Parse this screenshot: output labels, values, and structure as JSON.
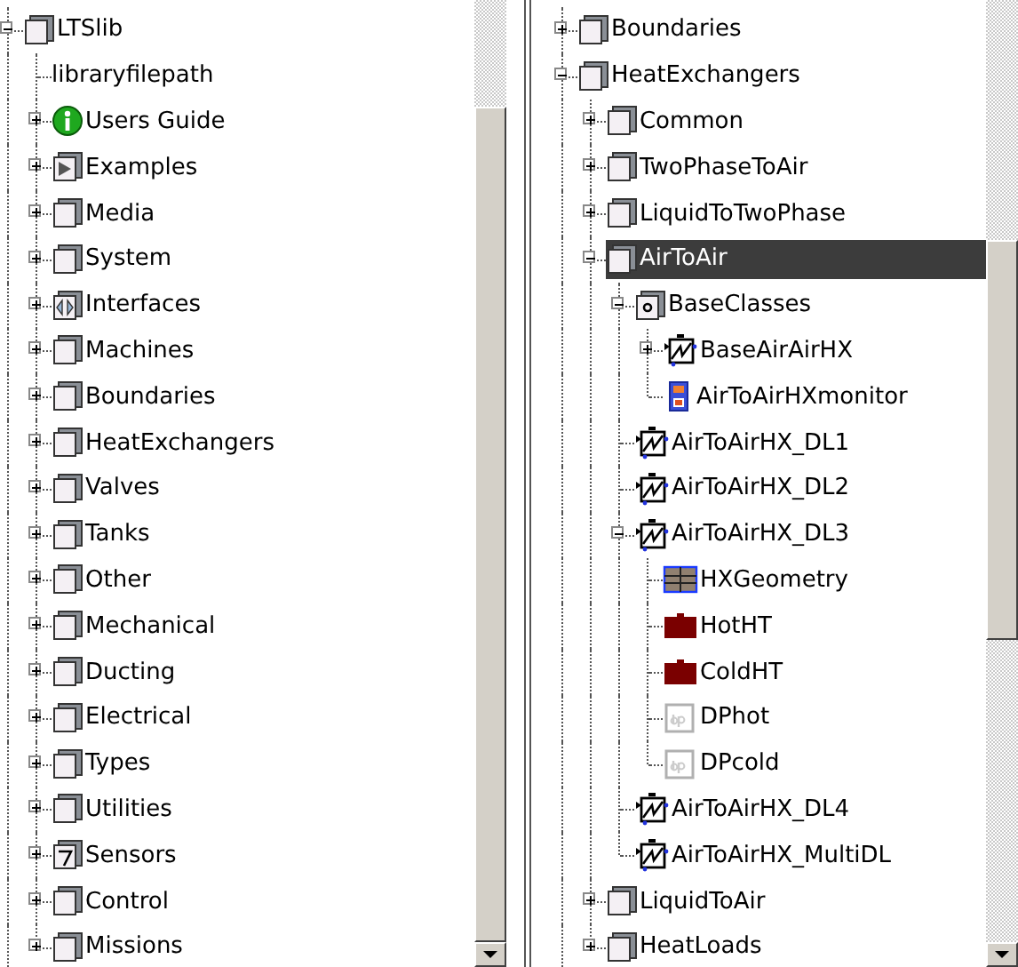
{
  "left_panel": {
    "tree": [
      {
        "label": "LTSlib",
        "kind": "package",
        "expanded": true,
        "selected": false,
        "children": [
          {
            "label": "libraryfilepath",
            "kind": "none",
            "selected": false
          },
          {
            "label": "Users Guide",
            "kind": "info",
            "expanded": false,
            "selected": false
          },
          {
            "label": "Examples",
            "kind": "play",
            "expanded": false,
            "selected": false
          },
          {
            "label": "Media",
            "kind": "package",
            "expanded": false,
            "selected": false
          },
          {
            "label": "System",
            "kind": "package",
            "expanded": false,
            "selected": false
          },
          {
            "label": "Interfaces",
            "kind": "interfaces",
            "expanded": false,
            "selected": false
          },
          {
            "label": "Machines",
            "kind": "package",
            "expanded": false,
            "selected": false
          },
          {
            "label": "Boundaries",
            "kind": "package",
            "expanded": false,
            "selected": false
          },
          {
            "label": "HeatExchangers",
            "kind": "package",
            "expanded": false,
            "selected": false
          },
          {
            "label": "Valves",
            "kind": "package",
            "expanded": false,
            "selected": false
          },
          {
            "label": "Tanks",
            "kind": "package",
            "expanded": false,
            "selected": false
          },
          {
            "label": "Other",
            "kind": "package",
            "expanded": false,
            "selected": false
          },
          {
            "label": "Mechanical",
            "kind": "package",
            "expanded": false,
            "selected": false
          },
          {
            "label": "Ducting",
            "kind": "package",
            "expanded": false,
            "selected": false
          },
          {
            "label": "Electrical",
            "kind": "package",
            "expanded": false,
            "selected": false
          },
          {
            "label": "Types",
            "kind": "package",
            "expanded": false,
            "selected": false
          },
          {
            "label": "Utilities",
            "kind": "package",
            "expanded": false,
            "selected": false
          },
          {
            "label": "Sensors",
            "kind": "sensor",
            "expanded": false,
            "selected": false
          },
          {
            "label": "Control",
            "kind": "package",
            "expanded": false,
            "selected": false
          },
          {
            "label": "Missions",
            "kind": "package",
            "expanded": false,
            "selected": false
          }
        ]
      }
    ]
  },
  "right_panel": {
    "tree": [
      {
        "label": "Boundaries",
        "kind": "package",
        "expanded": false,
        "selected": false
      },
      {
        "label": "HeatExchangers",
        "kind": "package",
        "expanded": true,
        "selected": false,
        "children": [
          {
            "label": "Common",
            "kind": "package",
            "expanded": false,
            "selected": false
          },
          {
            "label": "TwoPhaseToAir",
            "kind": "package",
            "expanded": false,
            "selected": false
          },
          {
            "label": "LiquidToTwoPhase",
            "kind": "package",
            "expanded": false,
            "selected": false
          },
          {
            "label": "AirToAir",
            "kind": "package",
            "expanded": true,
            "selected": true,
            "children": [
              {
                "label": "BaseClasses",
                "kind": "base",
                "expanded": true,
                "selected": false,
                "children": [
                  {
                    "label": "BaseAirAirHX",
                    "kind": "model",
                    "expanded": false,
                    "selected": false
                  },
                  {
                    "label": "AirToAirHXmonitor",
                    "kind": "monitor",
                    "selected": false
                  }
                ]
              },
              {
                "label": "AirToAirHX_DL1",
                "kind": "model",
                "selected": false
              },
              {
                "label": "AirToAirHX_DL2",
                "kind": "model",
                "selected": false
              },
              {
                "label": "AirToAirHX_DL3",
                "kind": "model",
                "expanded": true,
                "selected": false,
                "children": [
                  {
                    "label": "HXGeometry",
                    "kind": "record",
                    "selected": false
                  },
                  {
                    "label": "HotHT",
                    "kind": "block",
                    "selected": false
                  },
                  {
                    "label": "ColdHT",
                    "kind": "block",
                    "selected": false
                  },
                  {
                    "label": "DPhot",
                    "kind": "dp",
                    "selected": false
                  },
                  {
                    "label": "DPcold",
                    "kind": "dp",
                    "selected": false
                  }
                ]
              },
              {
                "label": "AirToAirHX_DL4",
                "kind": "model",
                "selected": false
              },
              {
                "label": "AirToAirHX_MultiDL",
                "kind": "model",
                "selected": false
              }
            ]
          },
          {
            "label": "LiquidToAir",
            "kind": "package",
            "expanded": false,
            "selected": false
          },
          {
            "label": "HeatLoads",
            "kind": "package",
            "expanded": false,
            "selected": false
          }
        ]
      }
    ]
  }
}
